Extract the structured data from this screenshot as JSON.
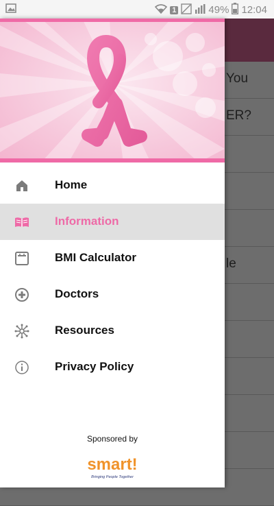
{
  "status_bar": {
    "battery": "49%",
    "time": "12:04",
    "sim_badge": "1"
  },
  "background_list": {
    "rows": [
      "You",
      "ER?",
      "",
      "",
      "",
      "le",
      "",
      "",
      "",
      "",
      "",
      ""
    ]
  },
  "drawer": {
    "menu": [
      {
        "label": "Home",
        "icon": "home-icon",
        "active": false
      },
      {
        "label": "Information",
        "icon": "book-icon",
        "active": true
      },
      {
        "label": "BMI Calculator",
        "icon": "scale-icon",
        "active": false
      },
      {
        "label": "Doctors",
        "icon": "plus-circle-icon",
        "active": false
      },
      {
        "label": "Resources",
        "icon": "network-icon",
        "active": false
      },
      {
        "label": "Privacy Policy",
        "icon": "info-icon",
        "active": false
      }
    ],
    "sponsor": {
      "label": "Sponsored by",
      "logo_text": "smart!",
      "logo_tagline": "Bringing People Together"
    }
  },
  "colors": {
    "accent_pink": "#ee6aa7",
    "header_dim": "#5a2a3e",
    "banner_pink": "#f7c9dc"
  }
}
